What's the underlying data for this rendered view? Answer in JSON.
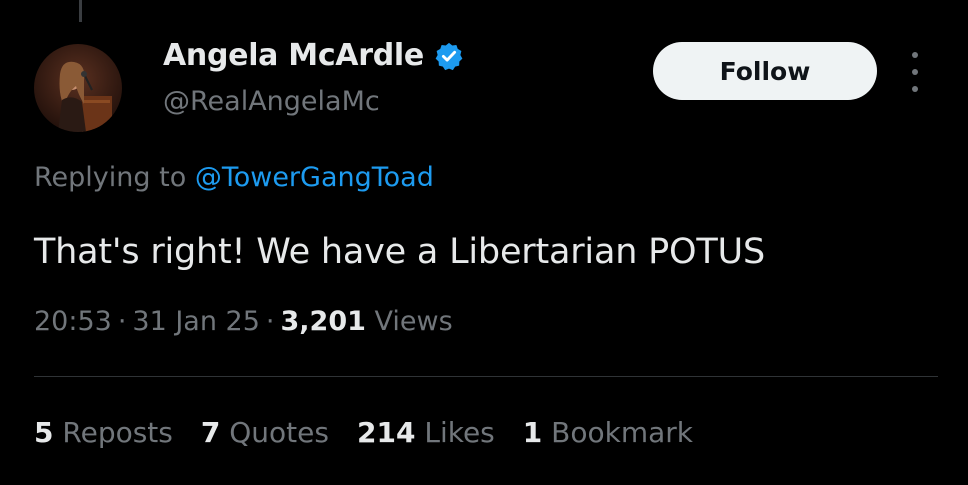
{
  "author": {
    "display_name": "Angela McArdle",
    "handle": "@RealAngelaMc",
    "verified": true
  },
  "actions": {
    "follow_label": "Follow"
  },
  "reply": {
    "prefix": "Replying to",
    "target_handle": "@TowerGangToad"
  },
  "tweet": {
    "text": "That's right! We have a Libertarian POTUS"
  },
  "meta": {
    "time": "20:53",
    "date": "31 Jan 25",
    "views_count": "3,201",
    "views_label": "Views"
  },
  "stats": [
    {
      "num": "5",
      "label": "Reposts"
    },
    {
      "num": "7",
      "label": "Quotes"
    },
    {
      "num": "214",
      "label": "Likes"
    },
    {
      "num": "1",
      "label": "Bookmark"
    }
  ],
  "colors": {
    "background": "#000000",
    "text_primary": "#e7e9ea",
    "text_secondary": "#71767b",
    "link": "#1d9bf0",
    "follow_bg": "#eff3f4",
    "verified": "#1d9bf0"
  },
  "icons": {
    "verified": "verified-badge-icon",
    "more": "more-options-icon"
  }
}
